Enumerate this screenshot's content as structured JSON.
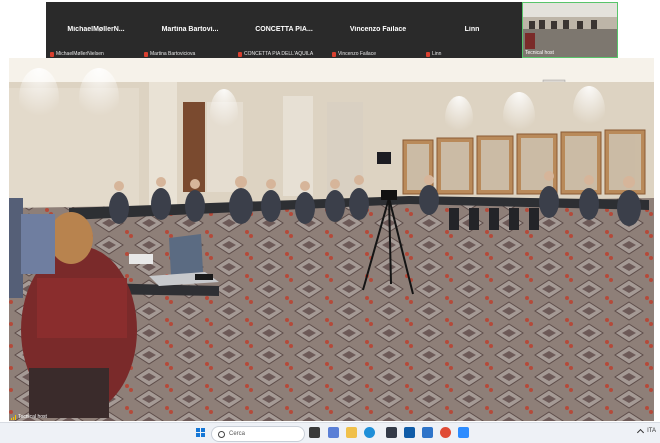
{
  "participants": [
    {
      "name": "MichaelMøllerN...",
      "label": "MichaelMøllerNielsen"
    },
    {
      "name": "Martina Bartovi...",
      "label": "Martina Bartoviciova"
    },
    {
      "name": "CONCETTA PIA...",
      "label": "CONCETTA PIA DELL'AQUILA"
    },
    {
      "name": "Vincenzo Failace",
      "label": "Vincenzo Failace"
    },
    {
      "name": "Linn",
      "label": "Linn"
    }
  ],
  "video_tile": {
    "label": "Tecnical host"
  },
  "main_video": {
    "label": "Tecnical host"
  },
  "taskbar": {
    "search_placeholder": "Cerca",
    "tray_lang": "ITA"
  },
  "colors": {
    "mic_off": "#d9402f",
    "active_speaker_border": "#58c46a",
    "taskbar_bg": "#eef1f6"
  },
  "icons": [
    "mic-off-icon",
    "signal-icon",
    "windows-start-icon",
    "search-icon",
    "chevron-up-icon"
  ]
}
